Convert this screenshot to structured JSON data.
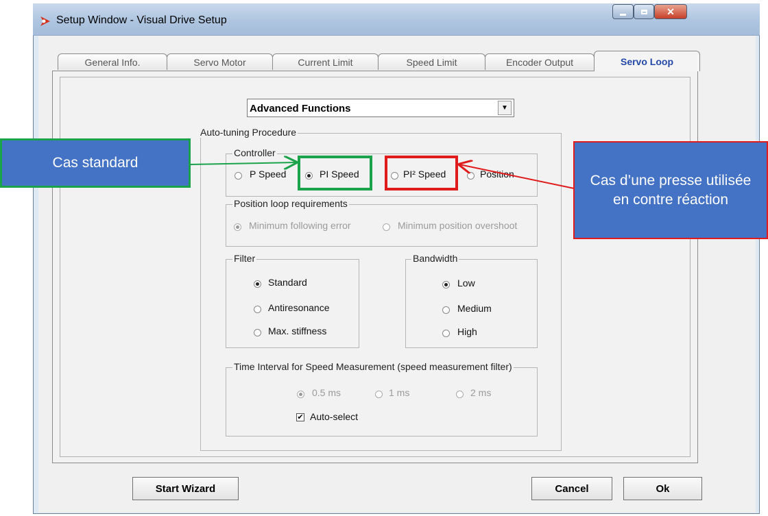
{
  "window": {
    "title": "Setup Window - Visual Drive Setup"
  },
  "tabs": [
    {
      "label": "General Info."
    },
    {
      "label": "Servo Motor"
    },
    {
      "label": "Current Limit"
    },
    {
      "label": "Speed Limit"
    },
    {
      "label": "Encoder Output"
    },
    {
      "label": "Servo Loop",
      "active": true
    }
  ],
  "combo": {
    "value": "Advanced Functions"
  },
  "autotuning": {
    "title": "Auto-tuning Procedure",
    "controller": {
      "title": "Controller",
      "options": [
        "P Speed",
        "PI Speed",
        "PI² Speed",
        "Position"
      ],
      "selected": "PI Speed"
    },
    "position_loop": {
      "title": "Position loop requirements",
      "options": [
        "Minimum following error",
        "Minimum position overshoot"
      ],
      "selected": "Minimum following error",
      "disabled": true
    },
    "filter": {
      "title": "Filter",
      "options": [
        "Standard",
        "Antiresonance",
        "Max. stiffness"
      ],
      "selected": "Standard"
    },
    "bandwidth": {
      "title": "Bandwidth",
      "options": [
        "Low",
        "Medium",
        "High"
      ],
      "selected": "Low"
    },
    "time_interval": {
      "title": "Time Interval for Speed Measurement (speed measurement filter)",
      "options": [
        "0.5 ms",
        "1 ms",
        "2 ms"
      ],
      "selected": "0.5 ms",
      "disabled": true,
      "auto_select_label": "Auto-select",
      "auto_select_checked": true
    }
  },
  "buttons": {
    "start_wizard": "Start Wizard",
    "cancel": "Cancel",
    "ok": "Ok"
  },
  "annotations": {
    "standard": "Cas standard",
    "press": "Cas d’une presse utilisée en contre réaction"
  },
  "colors": {
    "callout": "#4472c4",
    "green_box": "#1aa34a",
    "red_box": "#e01b1b",
    "active_tab": "#2348a8"
  }
}
